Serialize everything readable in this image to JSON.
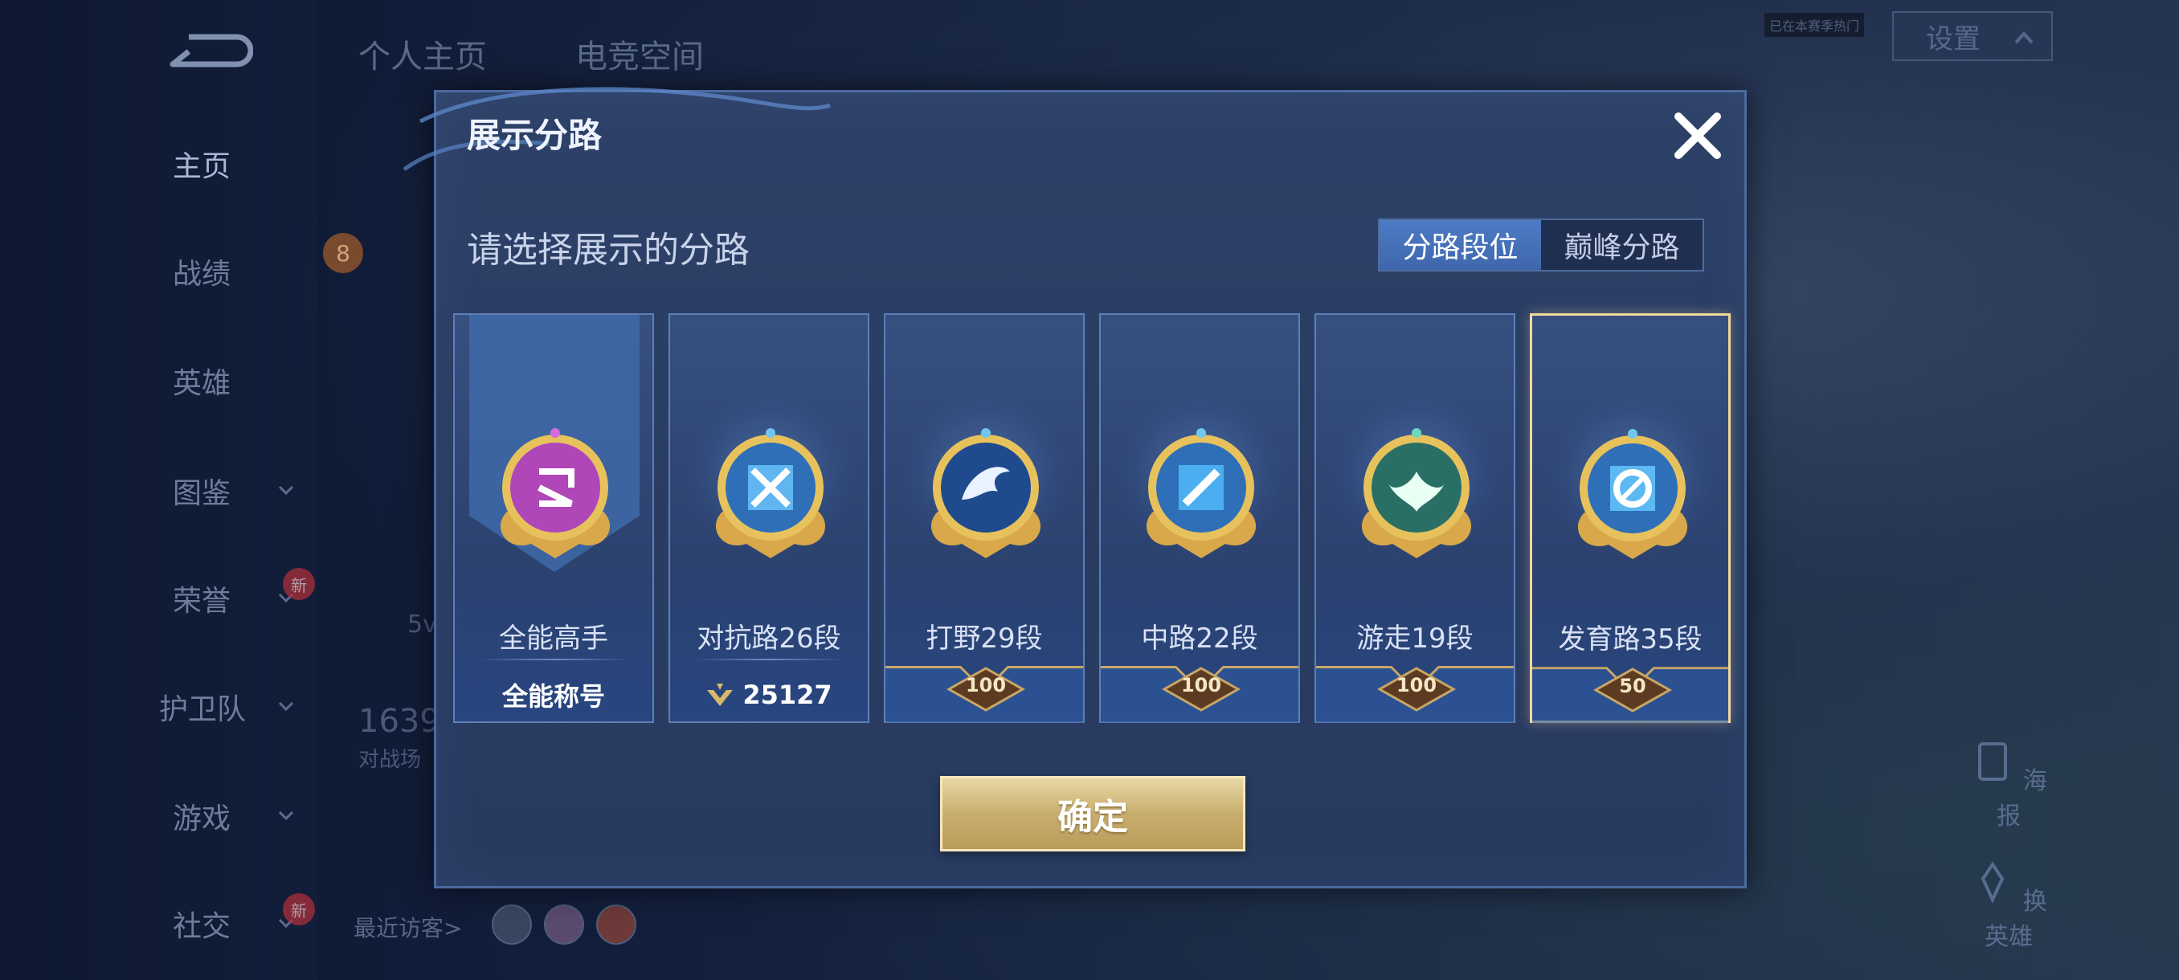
{
  "top_tabs": [
    "个人主页",
    "电竞空间"
  ],
  "settings_label": "设置",
  "tiny_label": "已在本赛季热门",
  "left_nav": [
    {
      "label": "主页",
      "active": true,
      "chevron": false,
      "new": false
    },
    {
      "label": "战绩",
      "active": false,
      "chevron": false,
      "new": false
    },
    {
      "label": "英雄",
      "active": false,
      "chevron": false,
      "new": false
    },
    {
      "label": "图鉴",
      "active": false,
      "chevron": true,
      "new": false
    },
    {
      "label": "荣誉",
      "active": false,
      "chevron": true,
      "new": true
    },
    {
      "label": "护卫队",
      "active": false,
      "chevron": true,
      "new": false
    },
    {
      "label": "游戏",
      "active": false,
      "chevron": true,
      "new": false
    },
    {
      "label": "社交",
      "active": false,
      "chevron": true,
      "new": true
    }
  ],
  "new_badge": "新",
  "background_profile": {
    "level": "8",
    "stat_number": "1639",
    "stat_label": "对战场",
    "partial": "5v",
    "recent_visitors": "最近访客>"
  },
  "side_actions": {
    "poster": "海报",
    "change_hero": "换英雄"
  },
  "modal": {
    "title": "展示分路",
    "subtitle": "请选择展示的分路",
    "toggle": {
      "left": "分路段位",
      "right": "巅峰分路",
      "active": "left"
    },
    "confirm": "确定",
    "cards": [
      {
        "name": "全能高手",
        "footer": "全能称号",
        "emblem": "allround-emblem-icon",
        "color": "#b047b8",
        "selected": false
      },
      {
        "name": "对抗路26段",
        "footer": "25127",
        "footer_icon": "peak-points-icon",
        "emblem": "clash-lane-emblem-icon",
        "color": "#5fb6f0",
        "selected": false
      },
      {
        "name": "打野29段",
        "stars": "100",
        "emblem": "jungle-emblem-icon",
        "color": "#2d5fa8",
        "selected": false
      },
      {
        "name": "中路22段",
        "stars": "100",
        "emblem": "mid-lane-emblem-icon",
        "color": "#4aaef0",
        "selected": false
      },
      {
        "name": "游走19段",
        "stars": "100",
        "emblem": "roam-emblem-icon",
        "color": "#3d9a86",
        "selected": false
      },
      {
        "name": "发育路35段",
        "stars": "50",
        "emblem": "farm-lane-emblem-icon",
        "color": "#5cb9f2",
        "selected": true
      }
    ]
  }
}
